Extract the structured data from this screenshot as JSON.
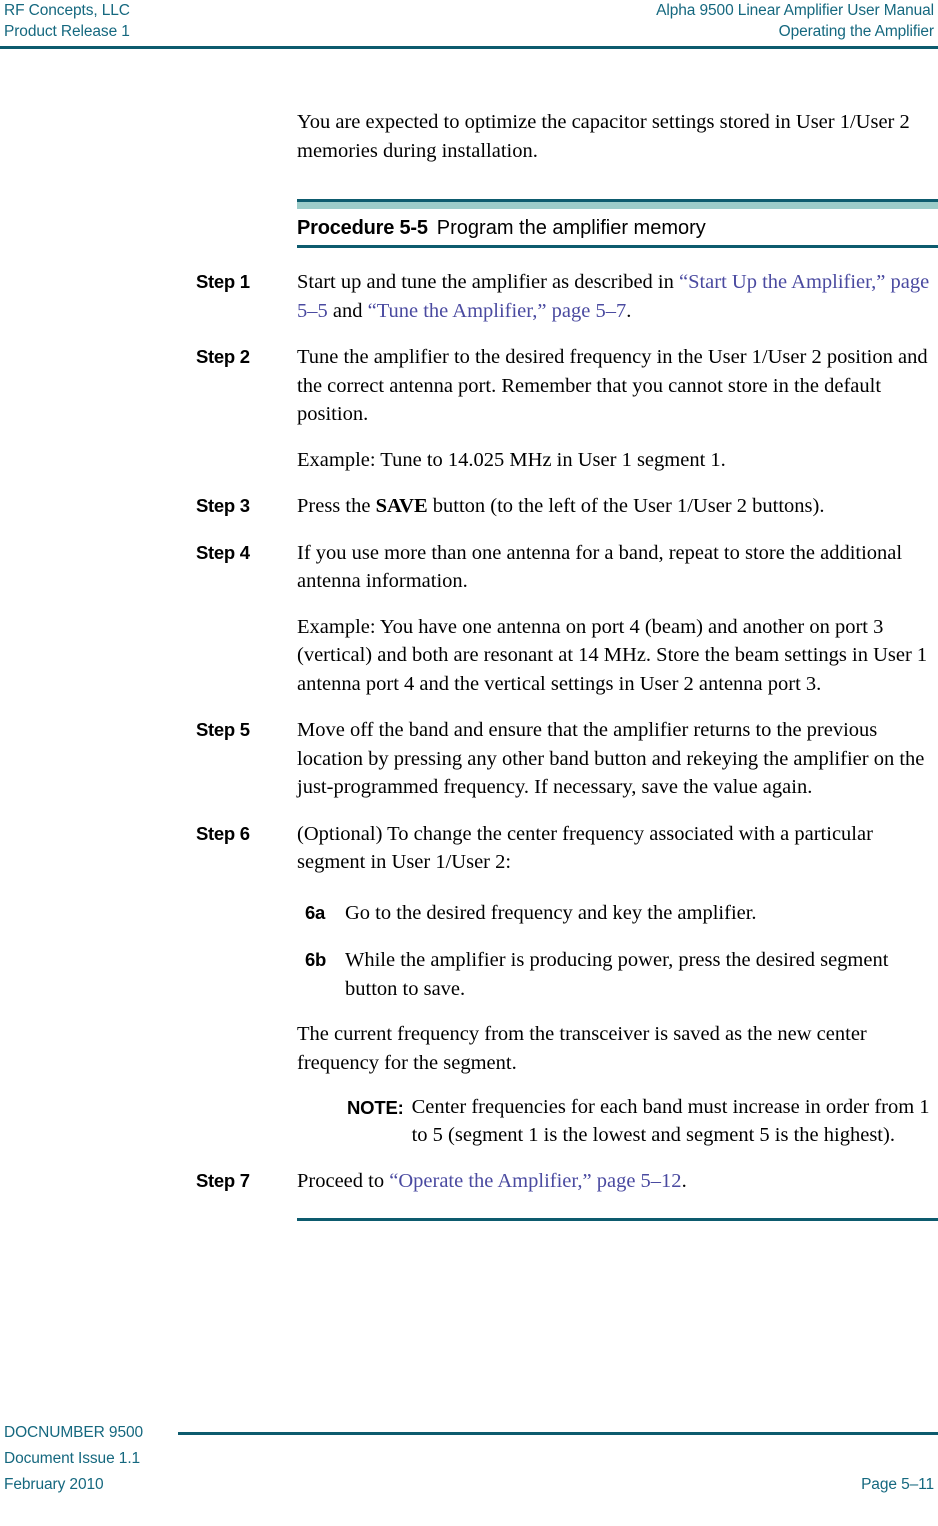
{
  "header": {
    "left_line1": "RF Concepts, LLC",
    "left_line2": "Product Release 1",
    "right_line1": "Alpha 9500 Linear Amplifier User Manual",
    "right_line2": "Operating the Amplifier",
    "rule_color": "#0d5b6e",
    "text_color": "#15687f"
  },
  "content": {
    "intro": "You are expected to optimize the capacitor settings stored in User 1/User 2 memories during installation.",
    "procedure": {
      "number": "Procedure 5-5",
      "title": "Program the amplifier memory",
      "band_light_color": "#9cccc9",
      "band_dark_color": "#0d5b6e"
    },
    "xref_color": "#4a4aa0",
    "steps": [
      {
        "label": "Step 1",
        "paragraphs": [
          {
            "parts": [
              {
                "text": "Start up and tune the amplifier as described in ",
                "style": "normal"
              },
              {
                "text": "“Start Up the Amplifier,” page 5–5",
                "style": "xref"
              },
              {
                "text": " and ",
                "style": "normal"
              },
              {
                "text": "“Tune the Amplifier,” page 5–7",
                "style": "xref"
              },
              {
                "text": ".",
                "style": "normal"
              }
            ]
          }
        ]
      },
      {
        "label": "Step 2",
        "paragraphs": [
          {
            "parts": [
              {
                "text": "Tune the amplifier to the desired frequency in the User 1/User 2 position and the correct antenna port. Remember that you cannot store in the default position.",
                "style": "normal"
              }
            ]
          },
          {
            "parts": [
              {
                "text": "Example: Tune to 14.025 MHz in User 1 segment 1.",
                "style": "normal"
              }
            ]
          }
        ]
      },
      {
        "label": "Step 3",
        "paragraphs": [
          {
            "parts": [
              {
                "text": "Press the ",
                "style": "normal"
              },
              {
                "text": "SAVE",
                "style": "bold"
              },
              {
                "text": " button (to the left of the User 1/User 2 buttons).",
                "style": "normal"
              }
            ]
          }
        ]
      },
      {
        "label": "Step 4",
        "paragraphs": [
          {
            "parts": [
              {
                "text": "If you use more than one antenna for a band, repeat to store the additional antenna information.",
                "style": "normal"
              }
            ]
          },
          {
            "parts": [
              {
                "text": "Example: You have one antenna on port 4 (beam) and another on port 3 (vertical) and both are resonant at 14 MHz. Store the beam settings in User 1 antenna port 4 and the vertical settings in User 2 antenna port 3.",
                "style": "normal"
              }
            ]
          }
        ]
      },
      {
        "label": "Step 5",
        "paragraphs": [
          {
            "parts": [
              {
                "text": "Move off the band and ensure that the amplifier returns to the previous location by pressing any other band button and rekeying the amplifier on the just-programmed frequency. If necessary, save the value again.",
                "style": "normal"
              }
            ]
          }
        ]
      },
      {
        "label": "Step 6",
        "paragraphs": [
          {
            "parts": [
              {
                "text": "(Optional) To change the center frequency associated with a particular segment in User 1/User 2:",
                "style": "normal"
              }
            ]
          }
        ],
        "substeps": [
          {
            "label": "6a",
            "text": "Go to the desired frequency and key the amplifier."
          },
          {
            "label": "6b",
            "text": "While the amplifier is producing power, press the desired segment button to save."
          }
        ],
        "after_substeps": "The current frequency from the transceiver is saved as the new center frequency for the segment.",
        "note": {
          "label": "NOTE:",
          "text": "Center frequencies for each band must increase in order from 1 to 5 (segment 1 is the lowest and segment 5 is the highest)."
        }
      },
      {
        "label": "Step 7",
        "paragraphs": [
          {
            "parts": [
              {
                "text": "Proceed to ",
                "style": "normal"
              },
              {
                "text": "“Operate the Amplifier,” page 5–12",
                "style": "xref"
              },
              {
                "text": ".",
                "style": "normal"
              }
            ]
          }
        ]
      }
    ]
  },
  "footer": {
    "doc_number": "DOCNUMBER 9500",
    "issue": "Document Issue 1.1",
    "date": "February 2010",
    "page": "Page 5–11",
    "rule_color": "#0d5b6e",
    "text_color": "#15687f"
  }
}
